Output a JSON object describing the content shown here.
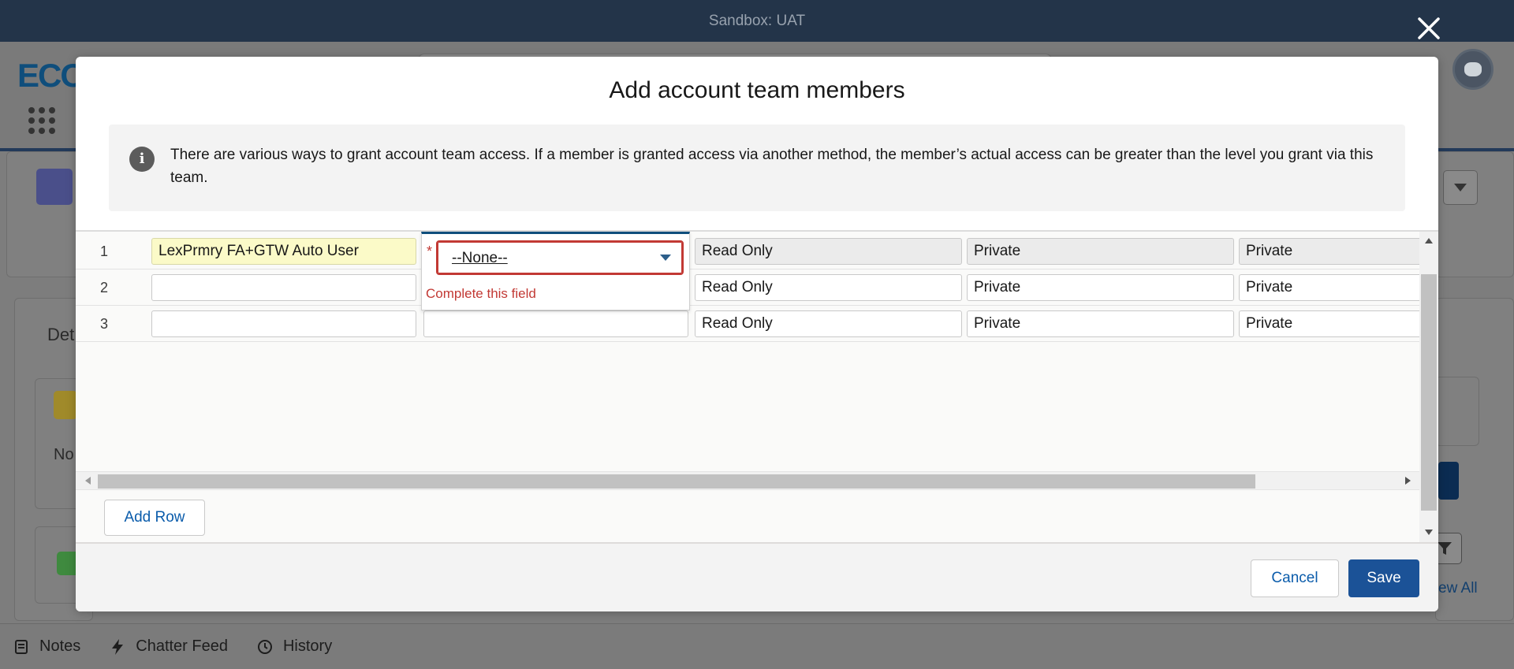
{
  "sandbox": {
    "label": "Sandbox: UAT"
  },
  "background": {
    "logo_text": "ECO",
    "card_heading_partial": "Det",
    "card_text_partial": "No",
    "view_all_partial": "ew All"
  },
  "modal": {
    "title": "Add account team members",
    "info_text": "There are various ways to grant account team access. If a member is granted access via another method, the member’s actual access can be greater than the level you grant via this team.",
    "rows": [
      {
        "num": "1",
        "user": "LexPrmry FA+GTW Auto User",
        "role": "",
        "account_access": "Read Only",
        "opportunity_access": "Private",
        "case_access": "Private"
      },
      {
        "num": "2",
        "user": "",
        "role": "",
        "account_access": "Read Only",
        "opportunity_access": "Private",
        "case_access": "Private"
      },
      {
        "num": "3",
        "user": "",
        "role": "",
        "account_access": "Read Only",
        "opportunity_access": "Private",
        "case_access": "Private"
      }
    ],
    "role_select": {
      "value": "--None--",
      "required_mark": "*",
      "error": "Complete this field"
    },
    "add_row_label": "Add Row",
    "cancel_label": "Cancel",
    "save_label": "Save"
  },
  "utility_bar": {
    "items": [
      {
        "label": "Notes",
        "icon": "notes-icon"
      },
      {
        "label": "Chatter Feed",
        "icon": "lightning-icon"
      },
      {
        "label": "History",
        "icon": "clock-icon"
      }
    ]
  },
  "colors": {
    "brand": "#1b5297",
    "error": "#c23934",
    "header": "#233449",
    "highlight": "#fbfac8"
  }
}
